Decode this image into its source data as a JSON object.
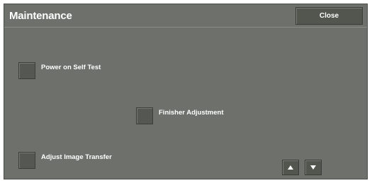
{
  "header": {
    "title": "Maintenance",
    "close_label": "Close"
  },
  "options": {
    "power_on_self_test": "Power on Self Test",
    "finisher_adjustment": "Finisher Adjustment",
    "adjust_image_transfer": "Adjust Image Transfer"
  },
  "pager": {
    "up_icon": "triangle-up-icon",
    "down_icon": "triangle-down-icon"
  },
  "colors": {
    "panel_background": "#6e716b",
    "button_background": "#53554f",
    "text": "#ffffff"
  }
}
